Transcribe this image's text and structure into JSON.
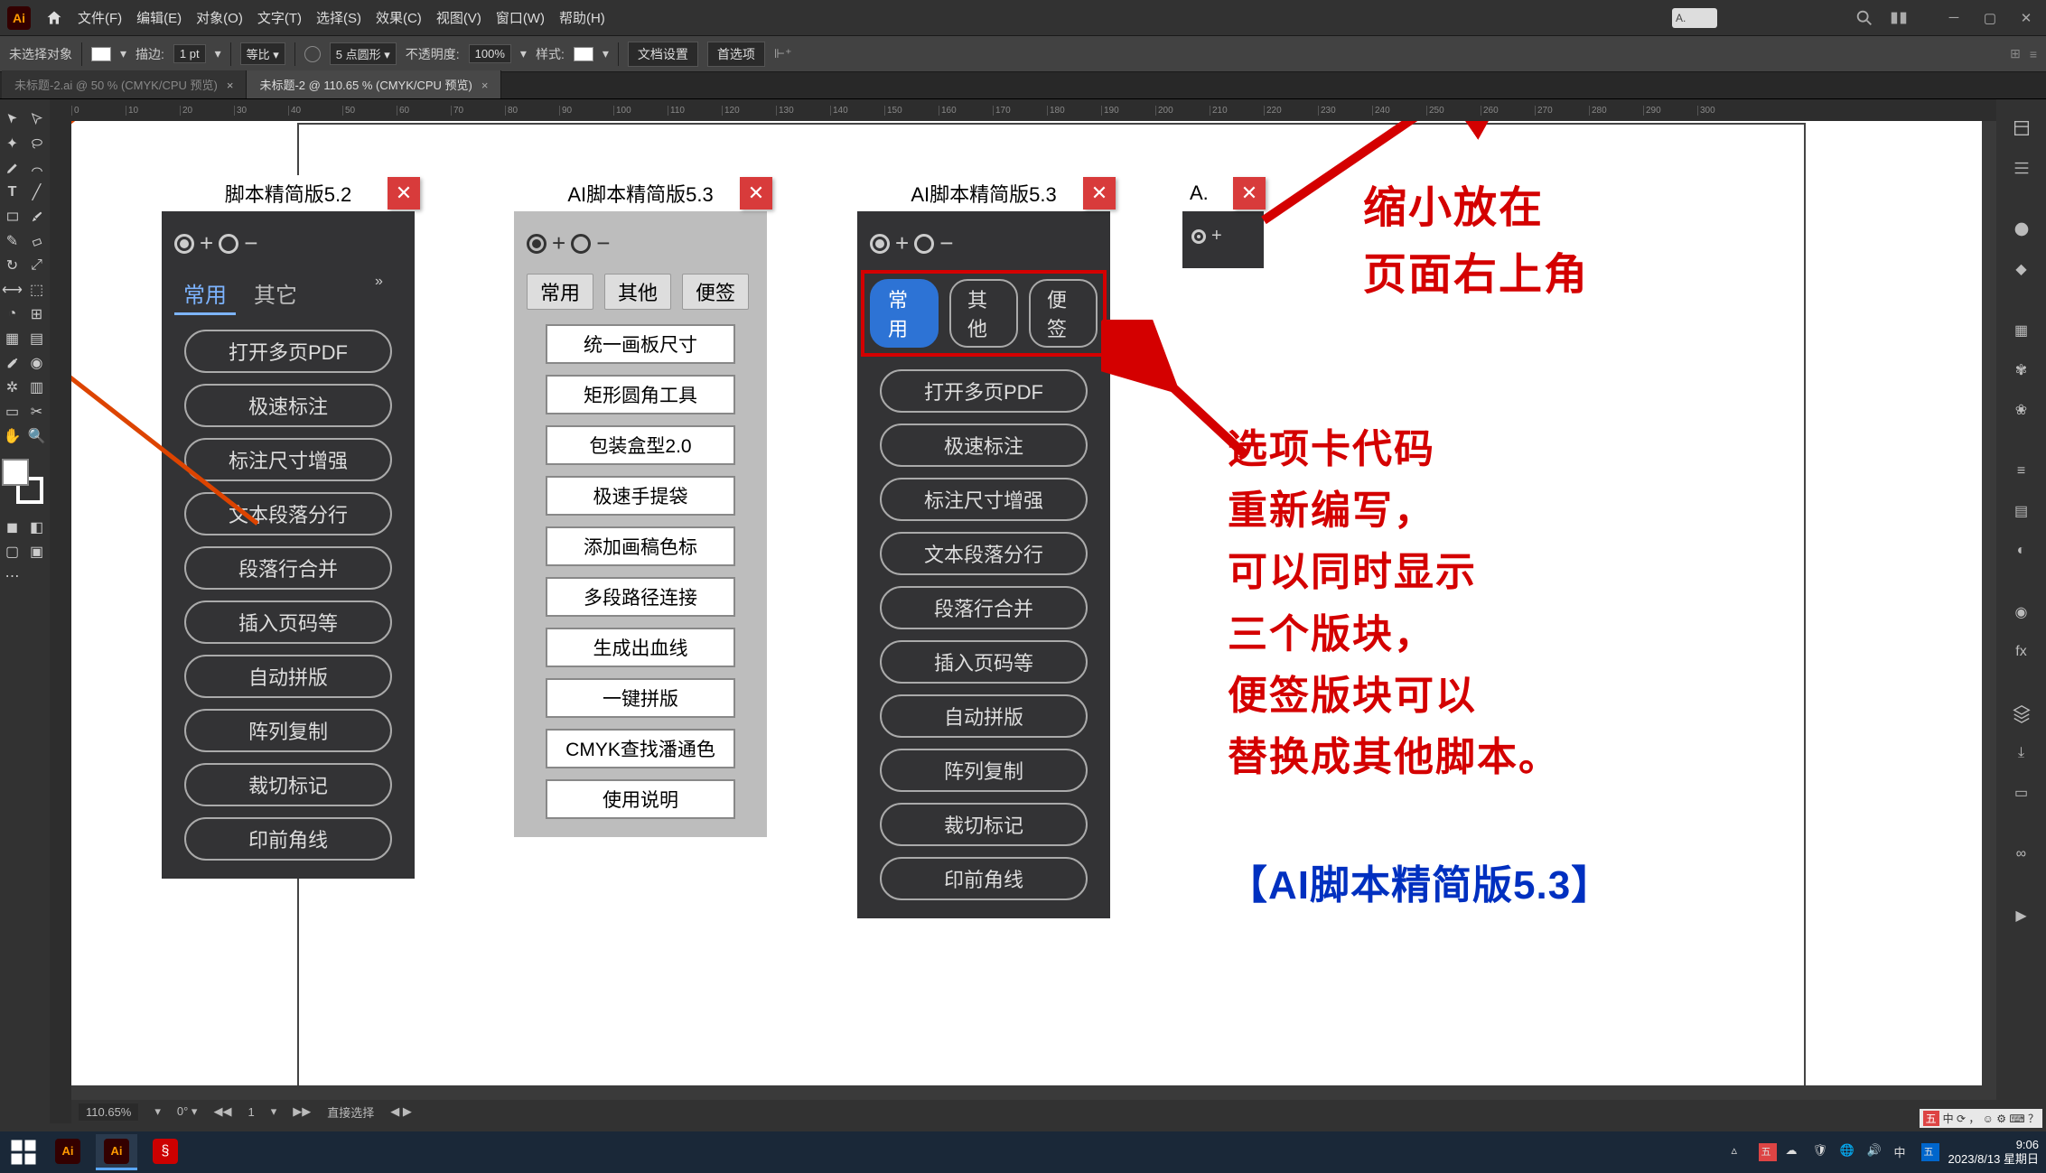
{
  "menubar": {
    "items": [
      "文件(F)",
      "编辑(E)",
      "对象(O)",
      "文字(T)",
      "选择(S)",
      "效果(C)",
      "视图(V)",
      "窗口(W)",
      "帮助(H)"
    ],
    "tinytab": "A."
  },
  "optbar": {
    "noSelection": "未选择对象",
    "strokeLabel": "描边:",
    "strokeVal": "1 pt",
    "uniform": "等比",
    "brushLabel": "5 点圆形",
    "opacityLabel": "不透明度:",
    "opacityVal": "100%",
    "styleLabel": "样式:",
    "docSetup": "文档设置",
    "prefs": "首选项"
  },
  "doctabs": [
    {
      "label": "未标题-2.ai @ 50 % (CMYK/CPU 预览)",
      "close": "×"
    },
    {
      "label": "未标题-2 @ 110.65 % (CMYK/CPU 预览)",
      "close": "×"
    }
  ],
  "status": {
    "zoom": "110.65%",
    "artboard": "1",
    "nav": "1",
    "tool": "直接选择"
  },
  "panel52": {
    "title": "脚本精简版5.2",
    "tabs": [
      "常用",
      "其它"
    ],
    "buttons": [
      "打开多页PDF",
      "极速标注",
      "标注尺寸增强",
      "文本段落分行",
      "段落行合并",
      "插入页码等",
      "自动拼版",
      "阵列复制",
      "裁切标记",
      "印前角线"
    ]
  },
  "panel53light": {
    "title": "AI脚本精简版5.3",
    "tabs": [
      "常用",
      "其他",
      "便签"
    ],
    "buttons": [
      "统一画板尺寸",
      "矩形圆角工具",
      "包装盒型2.0",
      "极速手提袋",
      "添加画稿色标",
      "多段路径连接",
      "生成出血线",
      "一键拼版",
      "CMYK查找潘通色",
      "使用说明"
    ]
  },
  "panel53dark": {
    "title": "AI脚本精简版5.3",
    "tabs": [
      "常用",
      "其他",
      "便签"
    ],
    "buttons": [
      "打开多页PDF",
      "极速标注",
      "标注尺寸增强",
      "文本段落分行",
      "段落行合并",
      "插入页码等",
      "自动拼版",
      "阵列复制",
      "裁切标记",
      "印前角线"
    ]
  },
  "panelMini": {
    "title": "A."
  },
  "anno": {
    "top": "缩小放在\n页面右上角",
    "mid": "选项卡代码\n重新编写，\n可以同时显示\n三个版块，\n便签版块可以\n替换成其他脚本。",
    "bottom": "【AI脚本精简版5.3】"
  },
  "ruler": [
    "0",
    "10",
    "20",
    "30",
    "40",
    "50",
    "60",
    "70",
    "80",
    "90",
    "100",
    "110",
    "120",
    "130",
    "140",
    "150",
    "160",
    "170",
    "180",
    "190",
    "200",
    "210",
    "220",
    "230",
    "240",
    "250",
    "260",
    "270",
    "280",
    "290",
    "300"
  ],
  "taskbar": {
    "time": "9:06",
    "date": "2023/8/13 星期日"
  }
}
